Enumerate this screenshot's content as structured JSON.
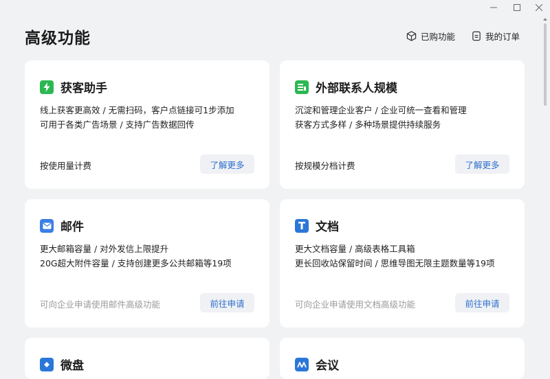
{
  "header": {
    "title": "高级功能",
    "purchased_label": "已购功能",
    "orders_label": "我的订单"
  },
  "colors": {
    "brand_blue": "#2f6fce",
    "green": "#2cb751",
    "mail_blue": "#3b7ee6",
    "doc_blue": "#2a77d8"
  },
  "cards": [
    {
      "title": "获客助手",
      "icon": "lightning-icon",
      "desc_lines": [
        "线上获客更高效 / 无需扫码，客户点链接可1步添加",
        "可用于各类广告场景 / 支持广告数据回传"
      ],
      "pricing": "按使用量计费",
      "button": "了解更多"
    },
    {
      "title": "外部联系人规模",
      "icon": "contacts-scale-icon",
      "desc_lines": [
        "沉淀和管理企业客户 / 企业可统一查看和管理",
        "获客方式多样 / 多种场景提供持续服务"
      ],
      "pricing": "按规模分档计费",
      "button": "了解更多"
    },
    {
      "title": "邮件",
      "icon": "mail-icon",
      "desc_lines": [
        "更大邮箱容量 / 对外发信上限提升",
        "20G超大附件容量 / 支持创建更多公共邮箱等19项"
      ],
      "pricing": "可向企业申请使用邮件高级功能",
      "button": "前往申请"
    },
    {
      "title": "文档",
      "icon": "document-icon",
      "desc_lines": [
        "更大文档容量 / 高级表格工具箱",
        "更长回收站保留时间 / 思维导图无限主题数量等19项"
      ],
      "pricing": "可向企业申请使用文档高级功能",
      "button": "前往申请"
    },
    {
      "title": "微盘",
      "icon": "drive-icon"
    },
    {
      "title": "会议",
      "icon": "meeting-icon"
    }
  ]
}
